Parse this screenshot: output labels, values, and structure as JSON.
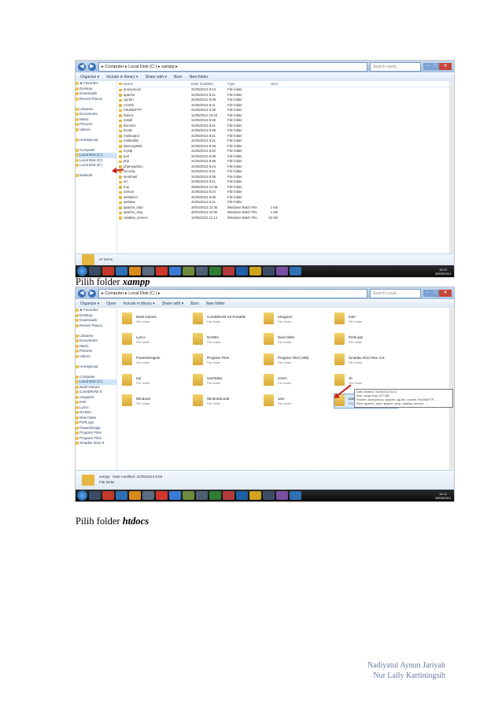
{
  "screenshot1": {
    "address": "▸ Computer ▸ Local Disk (C:) ▸ xampp ▸",
    "search_placeholder": "Search xamp...",
    "toolbar": [
      "Organize ▾",
      "Include in library ▾",
      "Share with ▾",
      "Burn",
      "New folder"
    ],
    "nav": [
      "★ Favorites",
      "Desktop",
      "Downloads",
      "Recent Places",
      "",
      "Libraries",
      "Documents",
      "Music",
      "Pictures",
      "Videos",
      "",
      "Homegroup",
      "",
      "Computer",
      "Local Disk (C:)",
      "Local Disk (D:)",
      "Local Disk (E:)",
      "",
      "Network"
    ],
    "columns": [
      "Name",
      "Date modified",
      "Type",
      "Size"
    ],
    "rows": [
      [
        "anonymous",
        "31/05/2013 8:24",
        "File folder",
        ""
      ],
      [
        "apache",
        "31/05/2013 8:21",
        "File folder",
        ""
      ],
      [
        "cgi-bin",
        "31/05/2013 8:38",
        "File folder",
        ""
      ],
      [
        "contrib",
        "31/05/2013 8:21",
        "File folder",
        ""
      ],
      [
        "FileZillaFTP",
        "31/05/2013 8:38",
        "File folder",
        ""
      ],
      [
        "htdocs",
        "11/05/2014 23:20",
        "File folder",
        ""
      ],
      [
        "install",
        "31/05/2013 8:38",
        "File folder",
        ""
      ],
      [
        "licenses",
        "31/05/2013 8:21",
        "File folder",
        ""
      ],
      [
        "locale",
        "31/05/2013 8:38",
        "File folder",
        ""
      ],
      [
        "mailoutput",
        "31/05/2013 8:21",
        "File folder",
        ""
      ],
      [
        "mailtodisk",
        "31/05/2013 8:21",
        "File folder",
        ""
      ],
      [
        "MercuryMail",
        "31/05/2013 8:38",
        "File folder",
        ""
      ],
      [
        "mysql",
        "31/05/2013 8:22",
        "File folder",
        ""
      ],
      [
        "perl",
        "31/05/2013 8:38",
        "File folder",
        ""
      ],
      [
        "php",
        "31/05/2013 8:38",
        "File folder",
        ""
      ],
      [
        "phpmyadmin",
        "31/05/2013 8:24",
        "File folder",
        ""
      ],
      [
        "security",
        "31/05/2013 8:21",
        "File folder",
        ""
      ],
      [
        "sendmail",
        "31/05/2013 8:38",
        "File folder",
        ""
      ],
      [
        "src",
        "31/05/2013 8:21",
        "File folder",
        ""
      ],
      [
        "tmp",
        "28/05/2014 10:49",
        "File folder",
        ""
      ],
      [
        "tomcat",
        "31/05/2013 8:24",
        "File folder",
        ""
      ],
      [
        "webalizer",
        "31/05/2013 8:38",
        "File folder",
        ""
      ],
      [
        "webdav",
        "31/05/2013 8:21",
        "File folder",
        ""
      ],
      [
        "apache_start",
        "30/04/2013 22:30",
        "Windows Batch File",
        "1 KB"
      ],
      [
        "apache_stop",
        "30/04/2013 22:30",
        "Windows Batch File",
        "1 KB"
      ],
      [
        "catalina_service",
        "12/05/2013 11:14",
        "Windows Batch File",
        "10 KB"
      ]
    ],
    "status": "47 items",
    "clock_time": "10:12",
    "clock_date": "28/05/2014"
  },
  "caption1": {
    "prefix": "Pilih folder ",
    "bold": "xampp"
  },
  "screenshot2": {
    "address": "▸ Computer ▸ Local Disk (C:) ▸",
    "search_placeholder": "Search Local...",
    "toolbar": [
      "Organize ▾",
      "Open",
      "Include in library ▾",
      "Share with ▾",
      "Burn",
      "New folder"
    ],
    "nav": [
      "★ Favorites",
      "Desktop",
      "Downloads",
      "Recent Places",
      "",
      "Libraries",
      "Documents",
      "Music",
      "Pictures",
      "Videos",
      "",
      "Homegroup",
      "",
      "Computer",
      "Local Disk (C:)",
      "Build Games",
      "CorelDRAW X",
      "eSupport",
      "Intel",
      "Lyrics",
      "NASBA",
      "New folder",
      "PerfLogs",
      "PowerDesign",
      "Program Files",
      "Program Files",
      "Smadav 2012 ▾"
    ],
    "tiles": [
      [
        "Build Games",
        "File folder"
      ],
      [
        "CorelDRAW X3 Portable",
        "File folder"
      ],
      [
        "eSupport",
        "File folder"
      ],
      [
        "Intel",
        "File folder"
      ],
      [
        "Lyrics",
        "File folder"
      ],
      [
        "NASBA",
        "File folder"
      ],
      [
        "New folder",
        "File folder"
      ],
      [
        "PerfLogs",
        "File folder"
      ],
      [
        "PowerDesigner",
        "File folder"
      ],
      [
        "Program Files",
        "File folder"
      ],
      [
        "Program Files (x86)",
        "File folder"
      ],
      [
        "Smadav 2012 Rev. 8.9",
        "File folder"
      ],
      [
        "sql",
        "File folder"
      ],
      [
        "UserData",
        "File folder"
      ],
      [
        "Users",
        "File folder"
      ],
      [
        "vb",
        "File folder"
      ],
      [
        "Windows",
        "File folder"
      ],
      [
        "WindowsLedd",
        "File folder"
      ],
      [
        "xam",
        "File folder"
      ],
      [
        "xampp",
        "File folder"
      ]
    ],
    "tooltip": [
      "Date created: 31/05/2013 8:21",
      "Size: larger than 477 MB",
      "Folders: anonymous, apache, cgi-bin, contrib, FileZillaFTP, ...",
      "Files: apache_start, apache_stop, catalina_service, ..."
    ],
    "detail_name": "xampp",
    "detail_meta": "Date modified: 31/05/2013 8:58",
    "detail_type": "File folder",
    "clock_time": "10:12",
    "clock_date": "28/05/2014"
  },
  "caption2": {
    "prefix": "Pilih folder ",
    "bold": "htdocs"
  },
  "footer": {
    "line1": "Nadiyatul Aynun Jariyah",
    "line2": "Nur Laily Kartiningsih"
  }
}
